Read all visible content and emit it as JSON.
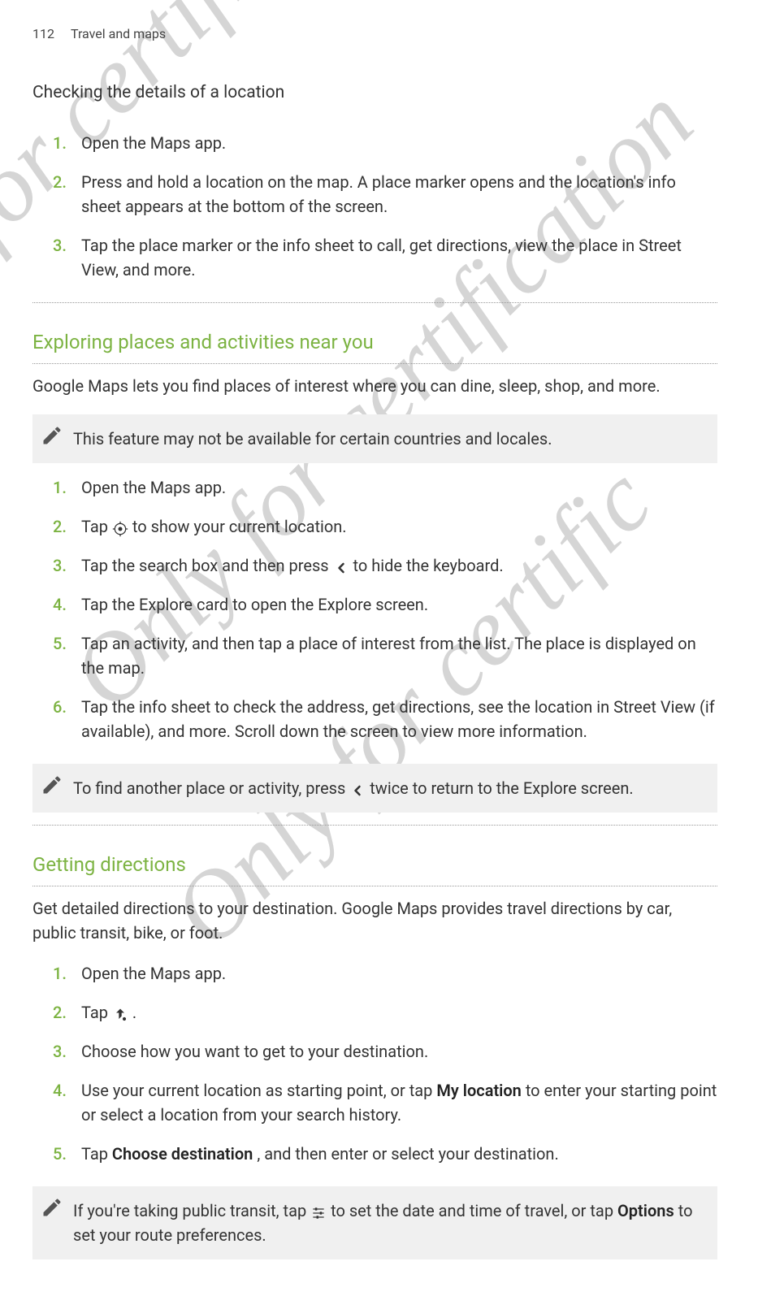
{
  "header": {
    "page_number": "112",
    "section": "Travel and maps"
  },
  "watermarks": {
    "wm1": "for certification",
    "wm2": "Only for certification",
    "wm3": "Only for certific"
  },
  "section1": {
    "title": "Checking the details of a location",
    "steps": [
      "Open the Maps app.",
      "Press and hold a location on the map. A place marker opens and the location's info sheet appears at the bottom of the screen.",
      "Tap the place marker or the info sheet to call, get directions, view the place in Street View, and more."
    ]
  },
  "section2": {
    "title": "Exploring places and activities near you",
    "intro": "Google Maps lets you find places of interest where you can dine, sleep, shop, and more.",
    "note1": "This feature may not be available for certain countries and locales.",
    "steps": {
      "s1": "Open the Maps app.",
      "s2a": "Tap ",
      "s2b": " to show your current location.",
      "s3a": "Tap the search box and then press ",
      "s3b": " to hide the keyboard.",
      "s4": "Tap the Explore card to open the Explore screen.",
      "s5": "Tap an activity, and then tap a place of interest from the list. The place is displayed on the map.",
      "s6": "Tap the info sheet to check the address, get directions, see the location in Street View (if available), and more. Scroll down the screen to view more information."
    },
    "note2a": "To find another place or activity, press ",
    "note2b": " twice to return to the Explore screen."
  },
  "section3": {
    "title": "Getting directions",
    "intro": "Get detailed directions to your destination. Google Maps provides travel directions by car, public transit, bike, or foot.",
    "steps": {
      "s1": "Open the Maps app.",
      "s2a": "Tap ",
      "s2b": ".",
      "s3": "Choose how you want to get to your destination.",
      "s4a": "Use your current location as starting point, or tap ",
      "s4bold": "My location",
      "s4b": " to enter your starting point or select a location from your search history.",
      "s5a": "Tap ",
      "s5bold": "Choose destination",
      "s5b": ", and then enter or select your destination."
    },
    "note3a": "If you're taking public transit, tap ",
    "note3b": " to set the date and time of travel, or tap ",
    "note3bold": "Options",
    "note3c": " to set your route preferences."
  }
}
